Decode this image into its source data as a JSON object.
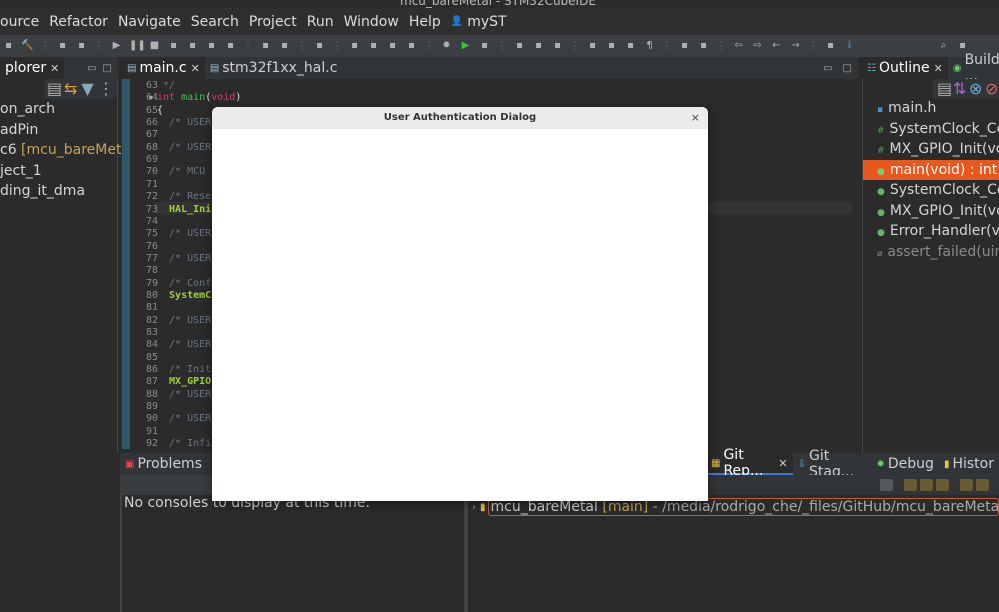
{
  "window": {
    "title": "mcu_bareMetal - STM32CubeIDE"
  },
  "menu": [
    "ource",
    "Refactor",
    "Navigate",
    "Search",
    "Project",
    "Run",
    "Window",
    "Help",
    "myST"
  ],
  "explorer": {
    "tab": "plorer",
    "items": [
      {
        "text": "on_arch"
      },
      {
        "text": "adPin"
      },
      {
        "text": "c6",
        "git": " [mcu_bareMeta"
      },
      {
        "text": "ject_1"
      },
      {
        "text": "ding_it_dma"
      }
    ]
  },
  "editor": {
    "tabs": [
      {
        "label": "main.c",
        "active": true
      },
      {
        "label": "stm32f1xx_hal.c",
        "active": false
      }
    ],
    "lines": [
      {
        "n": "63",
        "t": " */",
        "c": "cm"
      },
      {
        "n": "64",
        "t": "int main(void)",
        "c": "sig"
      },
      {
        "n": "65",
        "t": "{",
        "c": "fg"
      },
      {
        "n": "66",
        "t": "  /* USER",
        "c": "cm"
      },
      {
        "n": "67",
        "t": "",
        "c": "fg"
      },
      {
        "n": "68",
        "t": "  /* USER",
        "c": "cm"
      },
      {
        "n": "69",
        "t": "",
        "c": "fg"
      },
      {
        "n": "70",
        "t": "  /* MCU ",
        "c": "cm"
      },
      {
        "n": "71",
        "t": "",
        "c": "fg"
      },
      {
        "n": "72",
        "t": "  /* Rese",
        "c": "cm"
      },
      {
        "n": "73",
        "t": "  HAL_Ini",
        "c": "fn"
      },
      {
        "n": "74",
        "t": "",
        "c": "fg"
      },
      {
        "n": "75",
        "t": "  /* USER",
        "c": "cm"
      },
      {
        "n": "76",
        "t": "",
        "c": "fg"
      },
      {
        "n": "77",
        "t": "  /* USER",
        "c": "cm"
      },
      {
        "n": "78",
        "t": "",
        "c": "fg"
      },
      {
        "n": "79",
        "t": "  /* Conf",
        "c": "cm"
      },
      {
        "n": "80",
        "t": "  SystemC",
        "c": "fn"
      },
      {
        "n": "81",
        "t": "",
        "c": "fg"
      },
      {
        "n": "82",
        "t": "  /* USER",
        "c": "cm"
      },
      {
        "n": "83",
        "t": "",
        "c": "fg"
      },
      {
        "n": "84",
        "t": "  /* USER",
        "c": "cm"
      },
      {
        "n": "85",
        "t": "",
        "c": "fg"
      },
      {
        "n": "86",
        "t": "  /* Init",
        "c": "cm"
      },
      {
        "n": "87",
        "t": "  MX_GPIO",
        "c": "fn"
      },
      {
        "n": "88",
        "t": "  /* USER",
        "c": "cm"
      },
      {
        "n": "89",
        "t": "",
        "c": "fg"
      },
      {
        "n": "90",
        "t": "  /* USER",
        "c": "cm"
      },
      {
        "n": "91",
        "t": "",
        "c": "fg"
      },
      {
        "n": "92",
        "t": "  /* Infi",
        "c": "cm"
      }
    ]
  },
  "outline": {
    "tabs": [
      "Outline",
      "Build ..."
    ],
    "items": [
      {
        "icon": "▪",
        "text": "main.h",
        "color": "#4a90d9"
      },
      {
        "icon": "#",
        "text": "SystemClock_Co",
        "color": "#5a9a5a"
      },
      {
        "icon": "#",
        "text": "MX_GPIO_Init(vo",
        "color": "#5a9a5a"
      },
      {
        "icon": "●",
        "text": "main(void) : int",
        "color": "#5fb85f",
        "selected": true
      },
      {
        "icon": "●",
        "text": "SystemClock_Co",
        "color": "#5fb85f"
      },
      {
        "icon": "●",
        "text": "MX_GPIO_Init(vo",
        "color": "#5fb85f"
      },
      {
        "icon": "●",
        "text": "Error_Handler(vo",
        "color": "#5fb85f"
      },
      {
        "icon": "⌀",
        "text": "assert_failed(uin",
        "color": "#8a8a8a",
        "dim": true
      }
    ]
  },
  "console": {
    "tab": "Problems",
    "message": "No consoles to display at this time."
  },
  "git": {
    "tabs": [
      "Git Rep...",
      "Git Stag...",
      "Debug",
      "Histor"
    ],
    "repo": "mcu_bareMetal",
    "branch": "[main]",
    "path": " - /media/rodrigo_che/_files/GitHub/mcu_bareMetal/.git"
  },
  "dialog": {
    "title": "User Authentication Dialog",
    "close": "×"
  },
  "colors": {
    "selection": "#e8571e",
    "accent": "#2e5568"
  }
}
